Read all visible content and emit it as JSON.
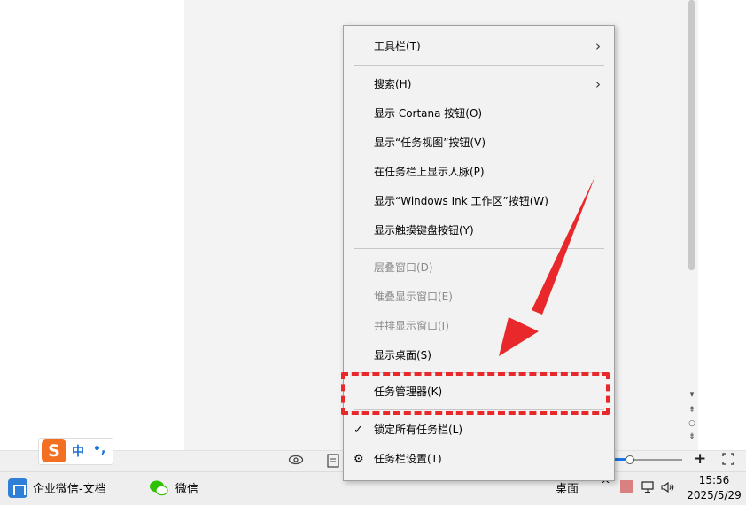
{
  "menu": {
    "items": [
      {
        "label": "工具栏(T)",
        "submenu": true,
        "enabled": true
      },
      {
        "label": "搜索(H)",
        "submenu": true,
        "enabled": true
      },
      {
        "label": "显示 Cortana 按钮(O)",
        "enabled": true
      },
      {
        "label": "显示“任务视图”按钮(V)",
        "enabled": true
      },
      {
        "label": "在任务栏上显示人脉(P)",
        "enabled": true
      },
      {
        "label": "显示“Windows Ink 工作区”按钮(W)",
        "enabled": true
      },
      {
        "label": "显示触摸键盘按钮(Y)",
        "enabled": true
      },
      {
        "label": "层叠窗口(D)",
        "enabled": false
      },
      {
        "label": "堆叠显示窗口(E)",
        "enabled": false
      },
      {
        "label": "并排显示窗口(I)",
        "enabled": false
      },
      {
        "label": "显示桌面(S)",
        "enabled": true
      },
      {
        "label": "任务管理器(K)",
        "enabled": true,
        "highlighted": true
      },
      {
        "label": "锁定所有任务栏(L)",
        "enabled": true,
        "checked": true
      },
      {
        "label": "任务栏设置(T)",
        "enabled": true,
        "icon": "gear-icon"
      }
    ],
    "chevron": "›",
    "check": "✓",
    "gear": "⚙"
  },
  "ime": {
    "logo": "S",
    "mode": "中",
    "punct": "•,"
  },
  "taskbar": {
    "apps": [
      {
        "label": "企业微信-文档",
        "icon": "wecom-icon"
      },
      {
        "label": "微信",
        "icon": "wechat-icon"
      }
    ],
    "desktop_label": "桌面",
    "tray_chevron": "^",
    "time": "15:56",
    "date": "2025/5/29"
  },
  "statusbar": {
    "zoom_plus": "+"
  },
  "annotation_color": "#e8282a"
}
